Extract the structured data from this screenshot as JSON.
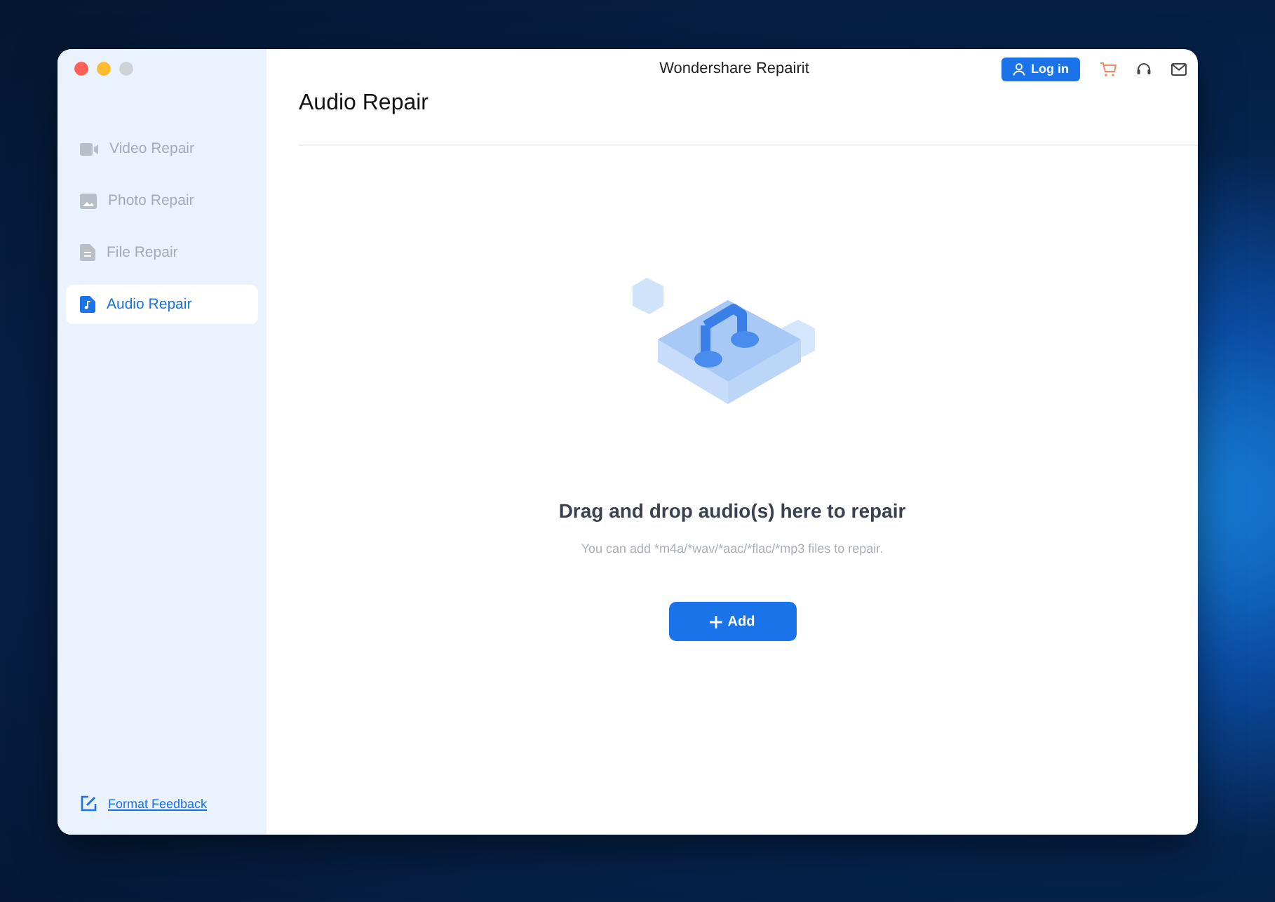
{
  "window": {
    "title": "Wondershare Repairit"
  },
  "header": {
    "login_button": "Log in"
  },
  "sidebar": {
    "items": [
      {
        "label": "Video Repair",
        "kind": "video",
        "selected": false
      },
      {
        "label": "Photo Repair",
        "kind": "photo",
        "selected": false
      },
      {
        "label": "File Repair",
        "kind": "file",
        "selected": false
      },
      {
        "label": "Audio Repair",
        "kind": "audio",
        "selected": true
      }
    ],
    "feedback_link": "Format Feedback"
  },
  "main": {
    "title": "Audio Repair",
    "drop_heading": "Drag and drop audio(s) here to repair",
    "drop_hint": "You can add *m4a/*wav/*aac/*flac/*mp3 files to repair.",
    "add_button": "Add"
  }
}
